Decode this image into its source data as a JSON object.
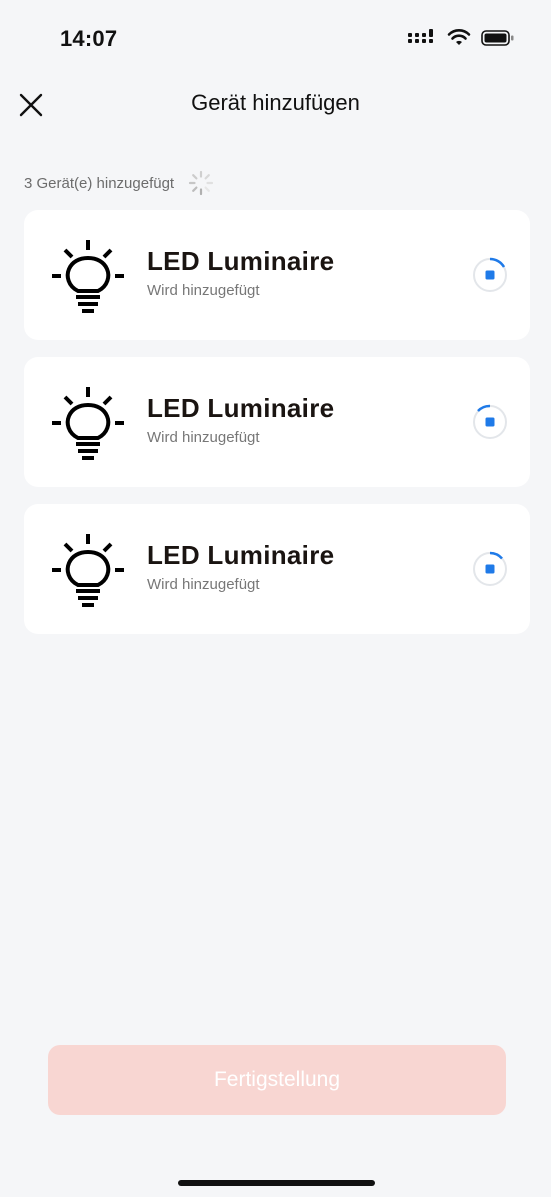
{
  "status_bar": {
    "time": "14:07",
    "signal_icon": "cellular-signal-icon",
    "wifi_icon": "wifi-icon",
    "battery_icon": "battery-icon"
  },
  "header": {
    "title": "Gerät hinzufügen",
    "close_icon": "close-icon"
  },
  "progress": {
    "label": "3 Gerät(e) hinzugefügt",
    "spinner_icon": "loading-spinner-icon"
  },
  "devices": [
    {
      "name": "LED Luminaire",
      "status": "Wird hinzugefügt",
      "icon": "light-bulb-icon"
    },
    {
      "name": "LED Luminaire",
      "status": "Wird hinzugefügt",
      "icon": "light-bulb-icon"
    },
    {
      "name": "LED Luminaire",
      "status": "Wird hinzugefügt",
      "icon": "light-bulb-icon"
    }
  ],
  "footer": {
    "finish_label": "Fertigstellung"
  },
  "colors": {
    "background": "#f5f6f8",
    "card": "#ffffff",
    "accent": "#1f7ae8",
    "button_disabled": "#f8d6d2"
  }
}
